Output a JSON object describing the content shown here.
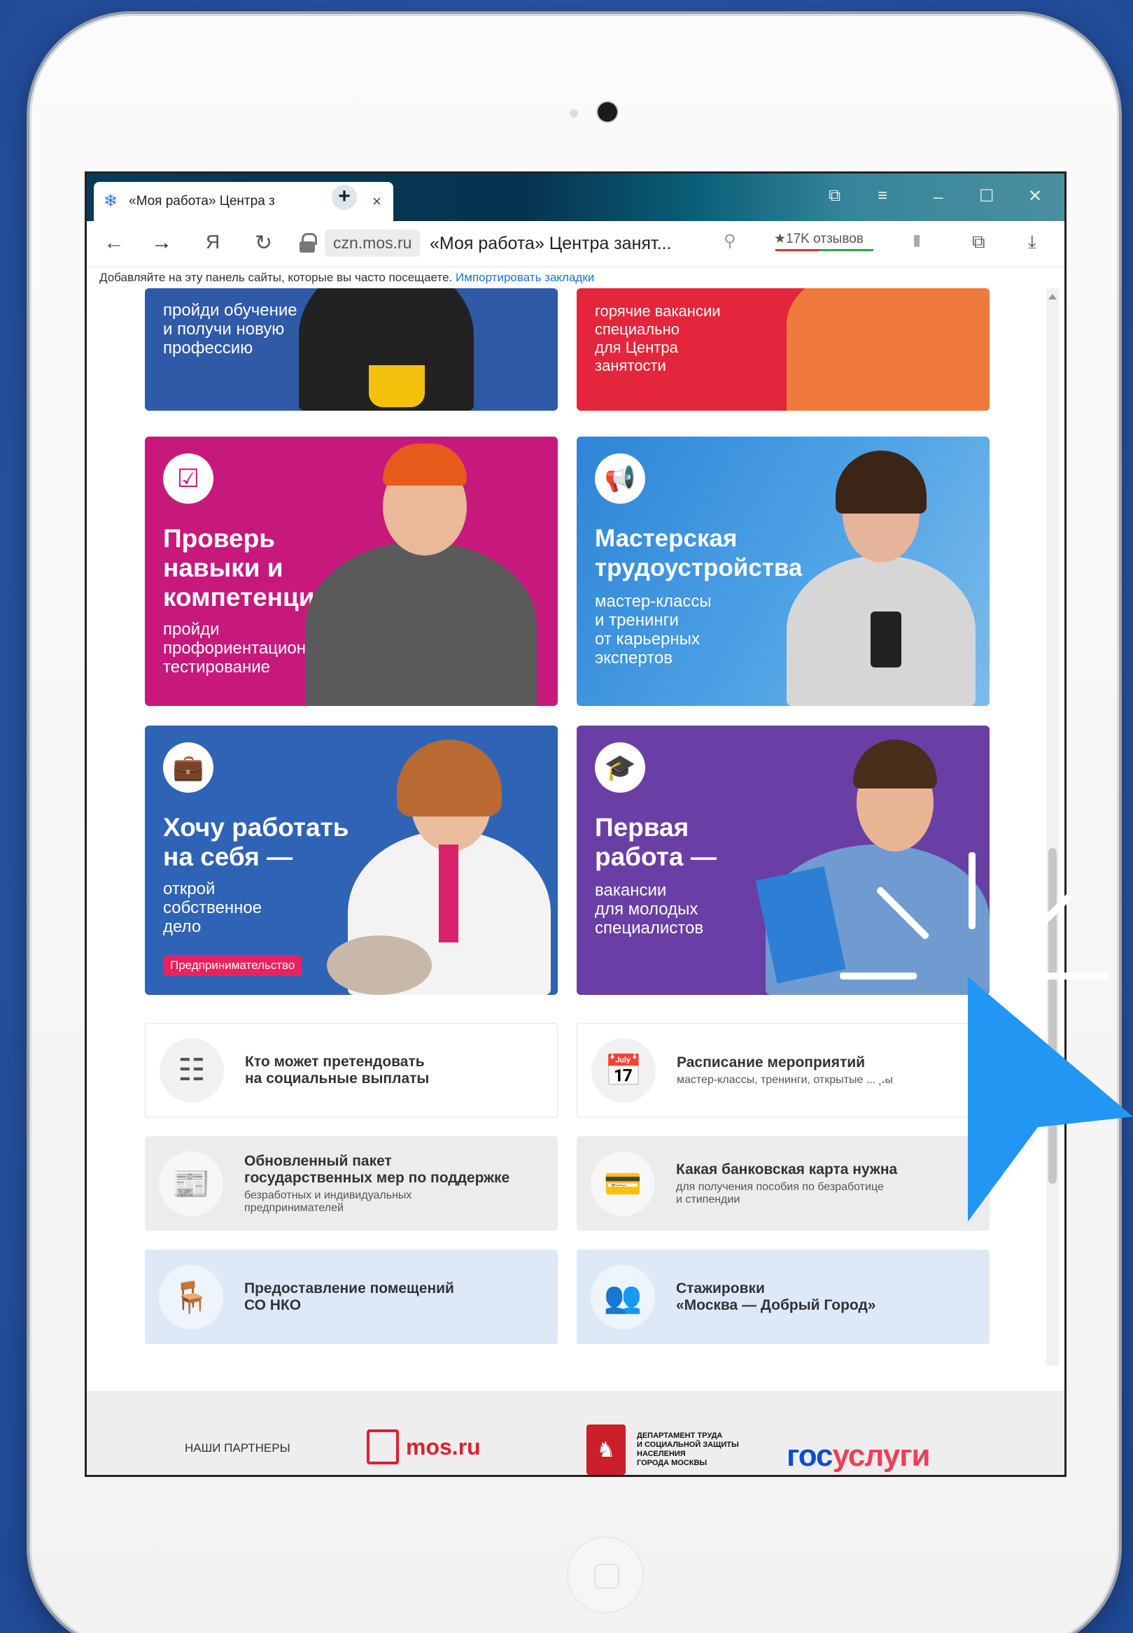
{
  "browser": {
    "tab_title": "«Моя работа» Центра з",
    "tab_close": "×",
    "new_tab": "+",
    "controls": [
      "⧉",
      "≡",
      "_",
      "☐",
      "✕"
    ],
    "address": {
      "back": "←",
      "forward": "→",
      "ya": "Я",
      "reload": "↻",
      "domain": "czn.mos.ru",
      "page_title": "«Моя работа» Центра занят...",
      "search_icon": "⚲",
      "reviews": "★17K отзывов",
      "bookmark": "▮",
      "extensions": "⧉",
      "downloads": "⤓"
    },
    "bookmarks_hint": "Добавляйте на эту панель сайты, которые вы часто посещаете.",
    "bookmarks_link": "Импортировать закладки"
  },
  "cards": [
    {
      "sub": "пройди обучение\nи получи новую\nпрофессию",
      "color": "#2f5aa8"
    },
    {
      "sub": "горячие вакансии\nспециально\nдля Центра\nзанятости",
      "color": "#e3263b"
    },
    {
      "headline": "Проверь\nнавыки и\nкомпетенции —",
      "sub": "пройди\nпрофориентационное\nтестирование",
      "color": "#c7197c",
      "icon": "checklist-icon"
    },
    {
      "headline": "Мастерская\nтрудоустройства",
      "sub": "мастер-классы\nи тренинги\nот карьерных\nэкспертов",
      "color": "#3c8fd8",
      "icon": "megaphone-icon"
    },
    {
      "headline": "Хочу работать\nна себя —",
      "sub": "открой\nсобственное\nдело",
      "tag": "Предпринимательство",
      "color": "#2f63b5",
      "icon": "briefcase-icon"
    },
    {
      "headline": "Первая\nработа —",
      "sub": "вакансии\nдля молодых\nспециалистов",
      "color": "#6a3fa5",
      "icon": "graduate-icon"
    }
  ],
  "tiles": [
    {
      "title": "Кто может претендовать\nна социальные выплаты",
      "sub": "",
      "icon": "document-checklist-icon"
    },
    {
      "title": "Расписание мероприятий",
      "sub": "мастер-классы, тренинги, открытые ... ры",
      "icon": "calendar-icon"
    },
    {
      "title": "Обновленный пакет\nгосударственных мер по поддержке",
      "sub": "безработных и индивидуальных\nпредпринимателей",
      "icon": "newspaper-icon"
    },
    {
      "title": "Какая банковская карта нужна",
      "sub": "для получения пособия по безработице\nи стипендии",
      "icon": "bank-card-icon"
    },
    {
      "title": "Предоставление помещений\nСО НКО",
      "sub": "",
      "icon": "meeting-room-icon"
    },
    {
      "title": "Стажировки\n«Москва — Добрый Город»",
      "sub": "",
      "icon": "people-network-icon"
    }
  ],
  "partners": {
    "label": "НАШИ ПАРТНЕРЫ",
    "mosru": "mos.ru",
    "dept": "ДЕПАРТАМЕНТ ТРУДА\nИ СОЦИАЛЬНОЙ ЗАЩИТЫ\nНАСЕЛЕНИЯ\nГОРОДА МОСКВЫ",
    "gosuslugi_1": "гос",
    "gosuslugi_2": "услуги"
  },
  "colors": {
    "cursor": "#2196f3",
    "accent": "#1a73d9"
  }
}
